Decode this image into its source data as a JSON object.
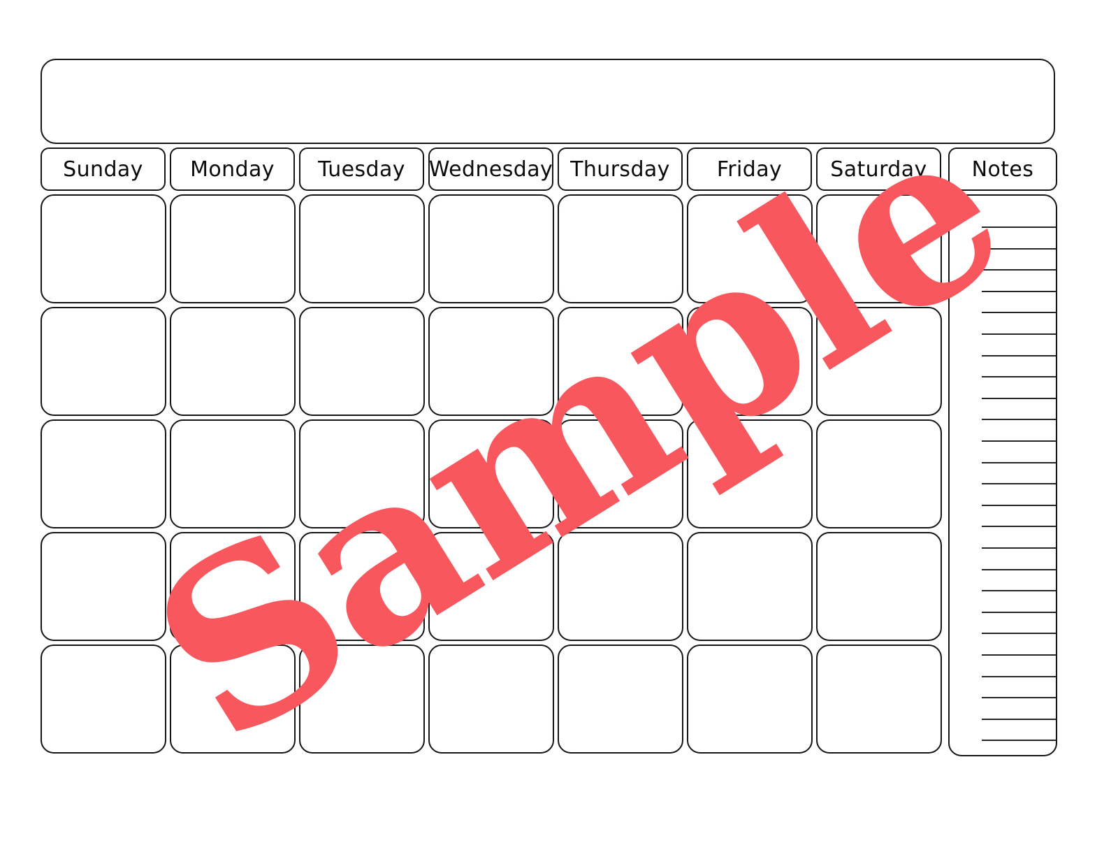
{
  "document": {
    "type": "blank-monthly-calendar-template",
    "title_banner_text": "",
    "title_banner_placeholder": ""
  },
  "header": {
    "day_names": [
      "Sunday",
      "Monday",
      "Tuesday",
      "Wednesday",
      "Thursday",
      "Friday",
      "Saturday"
    ],
    "notes_label": "Notes"
  },
  "grid": {
    "rows": 5,
    "columns": 7,
    "cells": [
      [
        "",
        "",
        "",
        "",
        "",
        "",
        ""
      ],
      [
        "",
        "",
        "",
        "",
        "",
        "",
        ""
      ],
      [
        "",
        "",
        "",
        "",
        "",
        "",
        ""
      ],
      [
        "",
        "",
        "",
        "",
        "",
        "",
        ""
      ],
      [
        "",
        "",
        "",
        "",
        "",
        "",
        ""
      ]
    ]
  },
  "notes": {
    "label": "Notes",
    "line_count": 25,
    "lines": [
      "",
      "",
      "",
      "",
      "",
      "",
      "",
      "",
      "",
      "",
      "",
      "",
      "",
      "",
      "",
      "",
      "",
      "",
      "",
      "",
      "",
      "",
      "",
      "",
      ""
    ]
  },
  "watermark": {
    "text": "Sample",
    "color": "#F9575E",
    "rotation_degrees": -32
  },
  "colors": {
    "page_background": "#FFFFFF",
    "cell_background": "#FFFFFF",
    "border": "#151515",
    "text": "#0B0B0B",
    "note_rule": "#262626",
    "watermark": "#F9575E"
  }
}
